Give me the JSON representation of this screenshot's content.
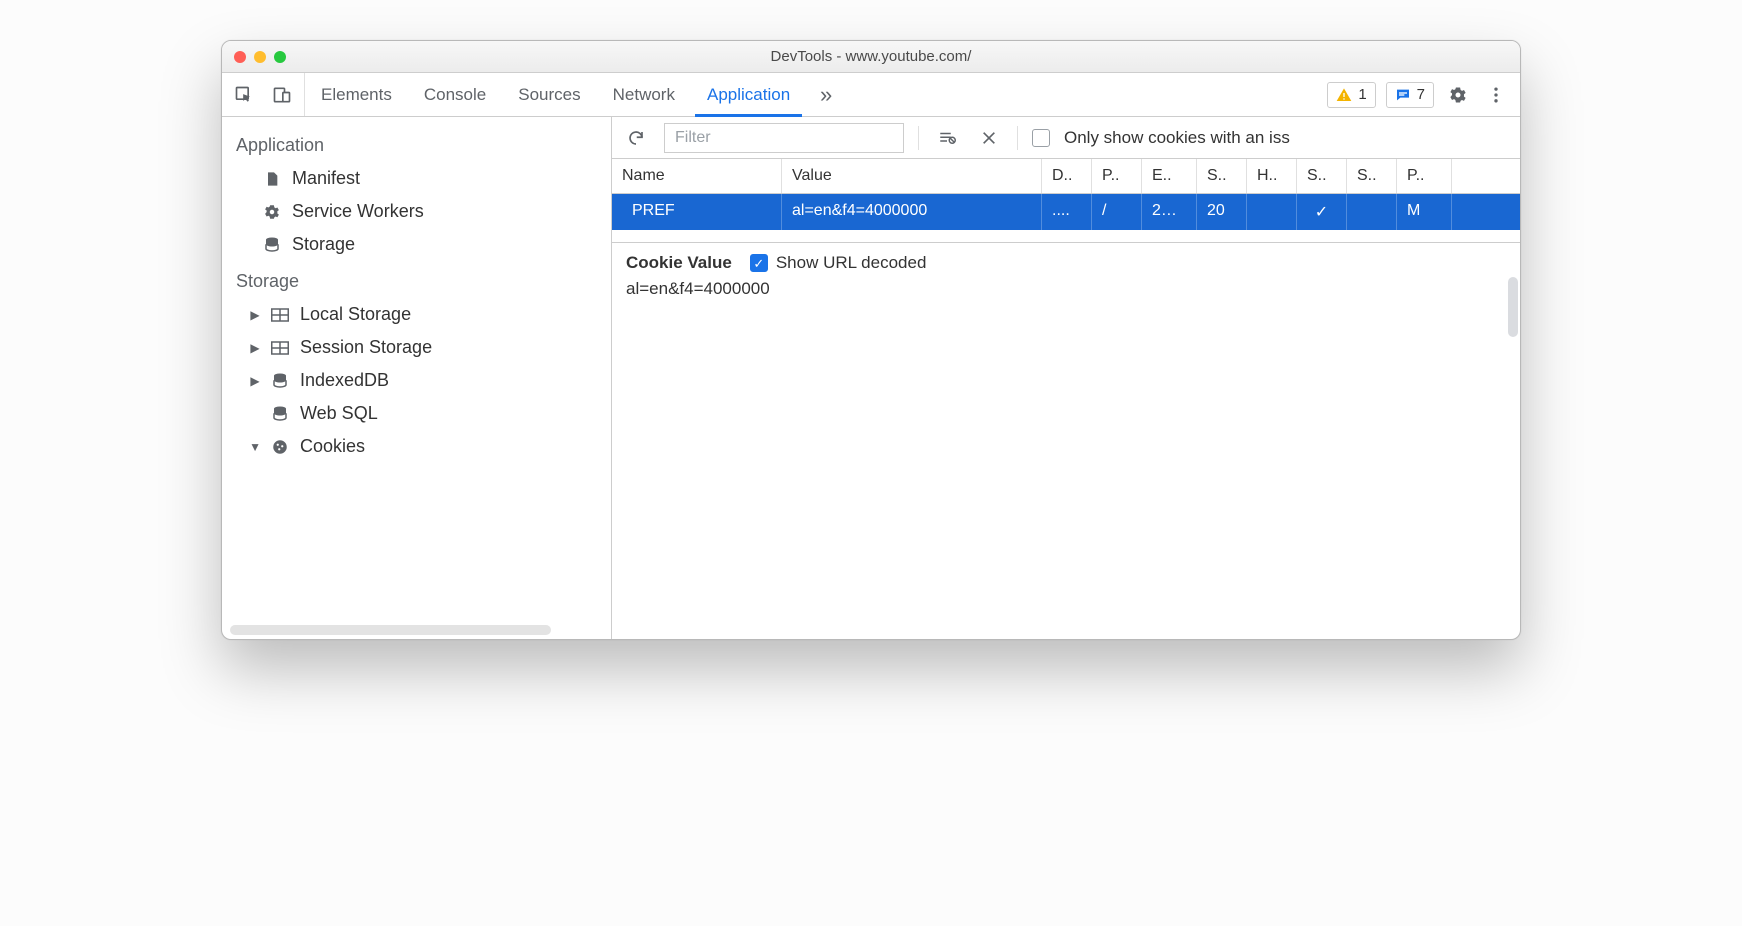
{
  "window": {
    "title": "DevTools - www.youtube.com/"
  },
  "toolbar": {
    "tabs": [
      "Elements",
      "Console",
      "Sources",
      "Network",
      "Application"
    ],
    "active_tab": "Application",
    "warn_count": "1",
    "msg_count": "7"
  },
  "sidebar": {
    "groups": [
      {
        "title": "Application",
        "items": [
          {
            "icon": "file",
            "label": "Manifest"
          },
          {
            "icon": "gear",
            "label": "Service Workers"
          },
          {
            "icon": "db",
            "label": "Storage"
          }
        ]
      },
      {
        "title": "Storage",
        "items": [
          {
            "icon": "grid",
            "label": "Local Storage",
            "caret": "right"
          },
          {
            "icon": "grid",
            "label": "Session Storage",
            "caret": "right"
          },
          {
            "icon": "db",
            "label": "IndexedDB",
            "caret": "right"
          },
          {
            "icon": "db",
            "label": "Web SQL"
          },
          {
            "icon": "cookie",
            "label": "Cookies",
            "caret": "down"
          }
        ]
      }
    ]
  },
  "filterbar": {
    "placeholder": "Filter",
    "only_issues_label": "Only show cookies with an iss"
  },
  "grid": {
    "columns": [
      "Name",
      "Value",
      "D..",
      "P..",
      "E..",
      "S..",
      "H..",
      "S..",
      "S..",
      "P.."
    ],
    "rows": [
      {
        "selected": true,
        "cells": [
          "PREF",
          "al=en&f4=4000000",
          "....",
          "/",
          "2…",
          "20",
          "",
          "✓",
          "",
          "M"
        ]
      }
    ]
  },
  "detail": {
    "title": "Cookie Value",
    "show_decoded_label": "Show URL decoded",
    "show_decoded_checked": true,
    "value": "al=en&f4=4000000"
  }
}
